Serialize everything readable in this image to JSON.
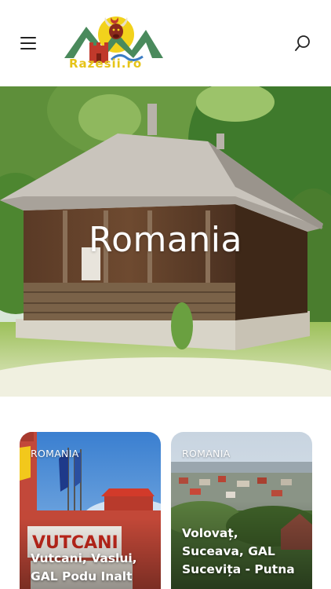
{
  "header": {
    "logo_text": "Razesii.ro"
  },
  "hero": {
    "title": "Romania"
  },
  "posts": [
    {
      "category": "ROMANIA",
      "title": "Vutcani, Vaslui, GAL Podu Inalt"
    },
    {
      "category": "ROMANIA",
      "title": "Volovaț, Suceava, GAL Sucevița - Putna"
    }
  ],
  "colors": {
    "logo_yellow": "#e6c419",
    "logo_green": "#4a8a5c",
    "logo_red": "#c0392b"
  }
}
